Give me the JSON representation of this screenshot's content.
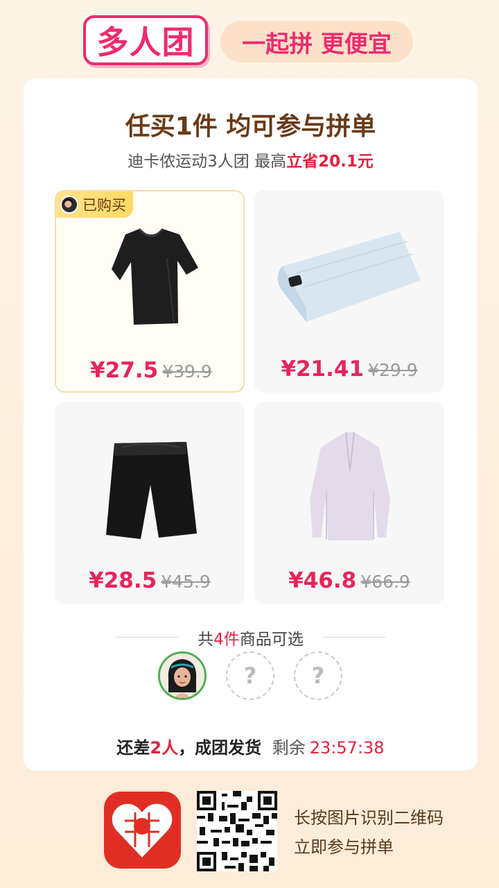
{
  "header": {
    "brand": "多人团",
    "slogan": "一起拼 更便宜"
  },
  "card": {
    "title": "任买1件 均可参与拼单",
    "subtitle_prefix": "迪卡侬运动3人团 最高",
    "subtitle_highlight": "立省20.1元"
  },
  "products": [
    {
      "name": "black t-shirt",
      "price": "¥27.5",
      "original_price": "¥39.9",
      "badge": "已购买"
    },
    {
      "name": "light blue towel",
      "price": "¥21.41",
      "original_price": "¥29.9"
    },
    {
      "name": "black shorts",
      "price": "¥28.5",
      "original_price": "¥45.9"
    },
    {
      "name": "lavender half-zip top",
      "price": "¥46.8",
      "original_price": "¥66.9"
    }
  ],
  "summary": {
    "prefix": "共",
    "count": "4件",
    "suffix": "商品可选"
  },
  "group": {
    "empty_slot_glyph": "?",
    "status_prefix": "还差",
    "status_count": "2人",
    "status_suffix": "，成团发货",
    "remaining_label": "剩余",
    "countdown": "23:57:38"
  },
  "footer": {
    "line1": "长按图片识别二维码",
    "line2": "立即参与拼单"
  },
  "colors": {
    "accent": "#ee2b6d",
    "price": "#e8245b",
    "highlight": "#e5213f",
    "title_brown": "#6b3a16",
    "member_ring": "#4caf50",
    "app_red": "#e02e24"
  }
}
